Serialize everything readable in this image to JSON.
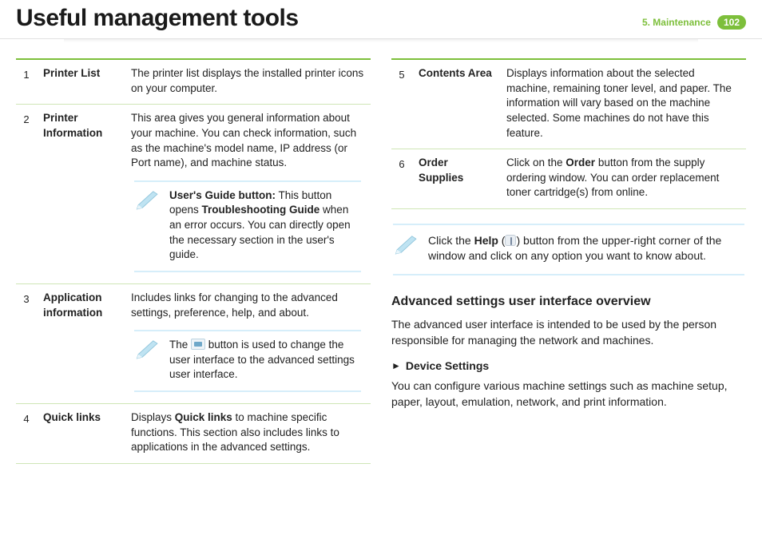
{
  "header": {
    "title": "Useful management tools",
    "chapter": "5.  Maintenance",
    "page": "102"
  },
  "left_rows": [
    {
      "num": "1",
      "label": "Printer List",
      "desc": "The printer list displays the installed printer icons on your computer."
    },
    {
      "num": "2",
      "label": "Printer Information",
      "desc": "This area gives you general information about your machine. You can check information, such as the machine's model name, IP address (or Port name), and machine status.",
      "note_lead": "User's Guide button:",
      "note_rest": " This button opens ",
      "note_bold2": "Troubleshooting Guide",
      "note_tail": " when an error occurs. You can directly open the necessary section in the user's guide."
    },
    {
      "num": "3",
      "label": "Application information",
      "desc": "Includes links for changing to the advanced settings, preference, help, and about.",
      "note3_a": "The ",
      "note3_b": " button is used to change the user interface to the advanced settings user interface."
    },
    {
      "num": "4",
      "label": "Quick links",
      "desc_a": "Displays ",
      "desc_bold": "Quick links",
      "desc_b": " to machine specific functions. This section also includes links to applications in the advanced settings."
    }
  ],
  "right_rows": [
    {
      "num": "5",
      "label": "Contents Area",
      "desc": "Displays information about the selected machine, remaining toner level, and paper. The information will vary based on the machine selected. Some machines do not have this feature."
    },
    {
      "num": "6",
      "label": "Order Supplies",
      "desc_a": "Click on the ",
      "desc_bold": "Order",
      "desc_b": " button from the supply ordering window. You can order replacement toner cartridge(s) from online."
    }
  ],
  "help_note": {
    "a": "Click the ",
    "bold": "Help",
    "b": " (",
    "c": ") button from the upper-right corner of the window and click on any option you want to know about."
  },
  "advanced": {
    "heading": "Advanced settings user interface overview",
    "para": "The advanced user interface is intended to be used by the person responsible for managing the network and machines.",
    "sub": "Device Settings",
    "body": "You can configure various machine settings such as machine setup, paper, layout, emulation, network, and print information."
  }
}
